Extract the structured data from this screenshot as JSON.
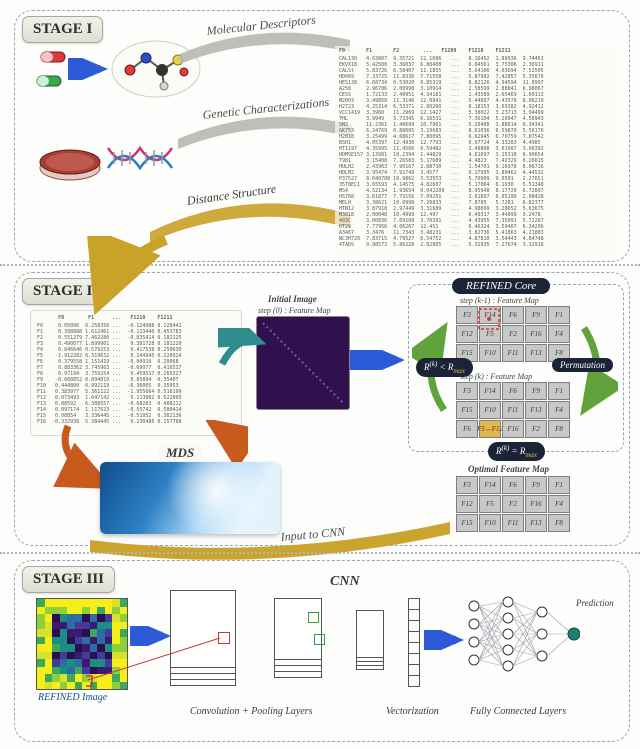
{
  "stage1": {
    "label": "STAGE I",
    "ribbon_molecular": "Molecular Descriptors",
    "ribbon_genetic": "Genetic Characterizations",
    "ribbon_distance": "Distance Structure",
    "matrix_header": "F0       F1       F2        ...   F1209    F1210    F1211",
    "matrix_rows": [
      "CAL130   4.63807  9.35721  12.1686   ...   8.16452  1.89936  9.74463",
      "EKVX18   5.42508  3.36037  6.88408   ...   6.84561  3.75306  2.36911",
      "CALSt    5.83726  6.58407  11.1855   ...   5.64106  4.03694  7.52505",
      "HD069    7.33725  11.8336  7.71558   ...   5.87992  7.42857  5.35676",
      "HES138   6.68734  0.53020  6.85319   ...   8.82126  4.94594  11.8997",
      "A258     2.96786  2.00998  3.10914   ...   2.58599  2.88841  6.98067",
      "CESS     1.72133  2.49951  4.34181   ...   1.43589  2.65469  1.60113",
      "M2003    3.49858  11.3146  12.0941   ...   5.44897  4.43570  8.06219",
      "H2723    4.25314  6.53371  2.80260   ...   8.18153  3.69382  4.92412",
      "VCC1419  3.3960   11.2969  12.1427   ...   5.38022  3.23713  3.94499",
      "THL      3.9949   3.73345  6.16531   ...   7.36104  5.20947  4.50943",
      "SM2      11.2361  1.48699  10.7961   ...   5.26408  3.88614  6.34341",
      "GK753    6.24769  0.88605  3.19683   ...   8.61036  6.59870  5.56176",
      "H2818    3.25499  4.68617  7.80095   ...   6.62945  6.70759  7.07542",
      "BSH1     4.05397  12.4930  12.7793   ...   6.97724  4.33283  4.4985 ",
      "HT1197   4.35995  11.4506  0.59482   ...   2.49808  3.01907  3.96392",
      "HDMSE157 3.13981  10.2394  1.44829   ...   4.61697  3.15318  6.90654",
      "T981     3.15408  7.26583  5.17689   ...   4.4823   7.42329  6.26615",
      "HULH2    2.43963  7.90167  2.08730   ...   1.54701  9.16978  6.06716",
      "HDLM2    3.95474  7.91749  3.4577    ...   6.17995  3.80462  4.44532",
      "P37527   8.040708 10.9862  3.53553   ...   5.70909  9.0501   2.27651",
      "35T8EC1  3.65593  4.14575  4.82607   ...   5.17064  6.1930   5.51348",
      "MS4      4.52134  1.93654  0.042209  ...   8.95948  8.17720  6.72897",
      "HS768    3.61877  7.73156  7.09251   ...   2.61697  6.05190  2.98428",
      "MELH     3.38621  10.0998  7.20833   ...   7.8705   5.7281   6.82377",
      "HTN12    3.87918  2.97449  3.31689   ...   4.98099  3.28652  5.63675",
      "M3818    2.00048  10.4999  12.497    ...   6.49317  3.44899  9.2478 ",
      "483C     3.00836  7.69108  3.70391   ...   4.43955  7.35091  5.72267",
      "HT29     7.77956  4.06267  12.451    ...   6.46324  3.50407  6.34206",
      "A3467    3.3476   11.7343  3.48231   ...   3.82736  5.41863  4.21883",
      "NC3H720  7.83715  4.79527  6.54752   ...   4.87810  3.54443  4.84748",
      "4TADS    9.98573  5.86228  2.82805   ...   5.32935  7.27674  3.32916"
    ]
  },
  "stage2": {
    "label": "STAGE II",
    "mds_label": "MDS",
    "refined_core": "REFINED Core",
    "initial_title": "Initial Image",
    "initial_sub": "step (0) : Feature Map",
    "kminus1_sub": "step (k-1) : Feature Map",
    "k_sub": "step (k) : Feature Map",
    "permutation": "Permutation",
    "cond_a": "R(k) < Rmax",
    "cond_b": "R(k) = Rmax",
    "opt_title": "Optimal Feature Map",
    "grid_labels_top": [
      "F3",
      "F14",
      "F6",
      "F9",
      "F1",
      "F12",
      "F5",
      "F2",
      "F16",
      "F4",
      "F15",
      "F10",
      "F11",
      "F13",
      "F8"
    ],
    "grid_labels_bottom": [
      "F3",
      "F14",
      "F6",
      "F9",
      "F1",
      "F15",
      "F10",
      "F11",
      "F13",
      "F4",
      "F6",
      "F5↔F12",
      "F16",
      "F2",
      "F8"
    ],
    "dist_header": "       F0        F1      ...   F1210    F1211",
    "dist_rows": [
      "F0     0.05090  0.258356 ...  -0.124988 0.128441",
      "F1     0.398888 1.612461 ...  -0.113440 0.453783",
      "F2     0.551279 7.462280 ...  -0.835414 0.182125",
      "F3     0.490077 1.899901 ...   0.381728 0.181220",
      "F4     0.846646 0.579253 ...   0.417538 0.250030",
      "F5    -1.912282 0.319632 ...   0.244945 0.220924",
      "F6     0.379558 1.151419 ...  -0.00910  0.20068 ",
      "F7     0.883362 3.745963 ...  -0.69977  0.416537",
      "F8     0.97194  3.759254 ...   0.459517 0.265327",
      "F9    -0.088852 0.894019 ...   0.85894  0.35407 ",
      "F10   0.444800  0.992119 ...  -0.36005  0.35953 ",
      "F11   0.383977  5.361122 ...  -1.955664 0.516199",
      "F12   0.073493  1.647142 ...   0.113082 0.622805",
      "F13   0.88592   6.388557 ...  -0.68283  0.488212",
      "F14   0.097174  1.117623 ...  -0.55742  0.580414",
      "F15   0.08854   3.336445 ...  -0.51052  0.382136",
      "F16  -0.332938  5.384445 ...   0.130480 0.157788"
    ],
    "input_label": "Input to CNN"
  },
  "stage3": {
    "label": "STAGE III",
    "ref_img": "REFINED Image",
    "cnn": "CNN",
    "conv": "Convolution + Pooling Layers",
    "vec": "Vectorization",
    "fc": "Fully Connected Layers",
    "pred": "Prediction"
  },
  "colors": {
    "gold": "#c9a22a",
    "teal": "#2e8c8c",
    "orange": "#c85a1e",
    "blue_arrow": "#2d5bd7",
    "dark": "#1b2436"
  }
}
